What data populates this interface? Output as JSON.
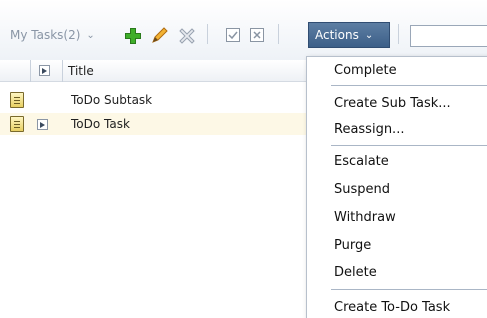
{
  "toolbar": {
    "view_label": "My Tasks(2)",
    "actions_label": "Actions",
    "add_icon": "plus-icon",
    "edit_icon": "pencil-icon",
    "delete_icon": "x-icon",
    "accent_color": "#3c5f88"
  },
  "table": {
    "title_header": "Title",
    "rows": [
      {
        "title": "ToDo Subtask",
        "expandable": false
      },
      {
        "title": "ToDo Task",
        "expandable": true
      }
    ]
  },
  "menu": {
    "items": [
      "Complete",
      "Create Sub Task...",
      "Reassign...",
      "Escalate",
      "Suspend",
      "Withdraw",
      "Purge",
      "Delete",
      "Create To-Do Task"
    ]
  }
}
